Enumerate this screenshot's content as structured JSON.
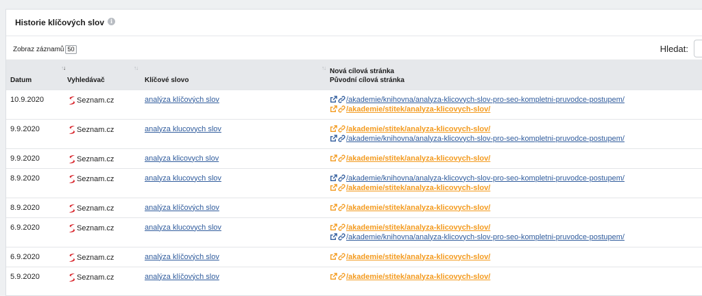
{
  "panel": {
    "title": "Historie klíčových slov",
    "info_icon": "info-icon"
  },
  "controls": {
    "page_len_label": "Zobraz záznamů",
    "page_len_value": "50",
    "search_label": "Hledat:"
  },
  "table": {
    "headers": {
      "date": "Datum",
      "engine": "Vyhledávač",
      "keyword": "Klíčové slovo",
      "new_target": "Nová cílová stránka",
      "orig_target": "Původní cílová stránka"
    },
    "rows": [
      {
        "date": "10.9.2020",
        "engine": "Seznam.cz",
        "keyword": "analýza klíčových slov",
        "urls": [
          {
            "text": "/akademie/knihovna/analyza-klicovych-slov-pro-seo-kompletni-pruvodce-postupem/",
            "kind": "new"
          },
          {
            "text": "/akademie/stitek/analyza-klicovych-slov/",
            "kind": "old"
          }
        ]
      },
      {
        "date": "9.9.2020",
        "engine": "Seznam.cz",
        "keyword": "analyza klucovych slov",
        "urls": [
          {
            "text": "/akademie/stitek/analyza-klicovych-slov/",
            "kind": "old"
          },
          {
            "text": "/akademie/knihovna/analyza-klicovych-slov-pro-seo-kompletni-pruvodce-postupem/",
            "kind": "new"
          }
        ]
      },
      {
        "date": "9.9.2020",
        "engine": "Seznam.cz",
        "keyword": "analyza klicovych slov",
        "urls": [
          {
            "text": "/akademie/stitek/analyza-klicovych-slov/",
            "kind": "old"
          }
        ]
      },
      {
        "date": "8.9.2020",
        "engine": "Seznam.cz",
        "keyword": "analyza klucovych slov",
        "urls": [
          {
            "text": "/akademie/knihovna/analyza-klicovych-slov-pro-seo-kompletni-pruvodce-postupem/",
            "kind": "new"
          },
          {
            "text": "/akademie/stitek/analyza-klicovych-slov/",
            "kind": "old"
          }
        ]
      },
      {
        "date": "8.9.2020",
        "engine": "Seznam.cz",
        "keyword": "analýza klíčových slov",
        "urls": [
          {
            "text": "/akademie/stitek/analyza-klicovych-slov/",
            "kind": "old"
          }
        ]
      },
      {
        "date": "6.9.2020",
        "engine": "Seznam.cz",
        "keyword": "analyza klucovych slov",
        "urls": [
          {
            "text": "/akademie/stitek/analyza-klicovych-slov/",
            "kind": "old"
          },
          {
            "text": "/akademie/knihovna/analyza-klicovych-slov-pro-seo-kompletni-pruvodce-postupem/",
            "kind": "new"
          }
        ]
      },
      {
        "date": "6.9.2020",
        "engine": "Seznam.cz",
        "keyword": "analýza klíčových slov",
        "urls": [
          {
            "text": "/akademie/stitek/analyza-klicovych-slov/",
            "kind": "old"
          }
        ]
      },
      {
        "date": "5.9.2020",
        "engine": "Seznam.cz",
        "keyword": "analýza klíčových slov",
        "urls": [
          {
            "text": "/akademie/stitek/analyza-klicovych-slov/",
            "kind": "old"
          }
        ]
      }
    ]
  },
  "colors": {
    "link_blue": "#2f5b9c",
    "link_orange": "#f39a1e",
    "seznam_red": "#d8232a"
  }
}
